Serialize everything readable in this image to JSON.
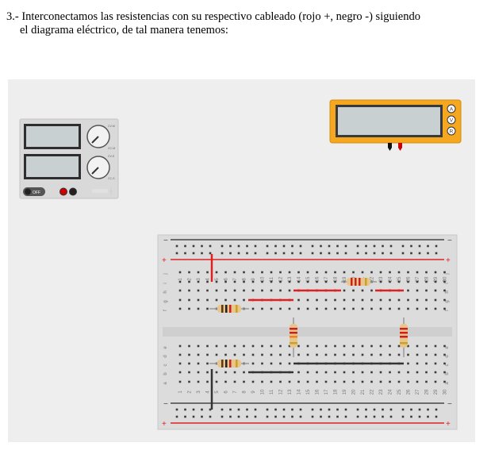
{
  "caption": {
    "line1": "3.- Interconectamos las resistencias con su respectivo cableado (rojo +, negro -) siguiendo",
    "line2": "el diagrama eléctrico, de tal manera tenemos:"
  },
  "power_supply": {
    "display1": "",
    "display2": "",
    "power_label": "OFF",
    "knob_labels": [
      "CV-M",
      "CC-M",
      "CV-S",
      "CC-S"
    ]
  },
  "multimeter": {
    "modes": [
      "A",
      "V",
      "R"
    ],
    "display": ""
  },
  "breadboard": {
    "rail_plus": "+",
    "rail_minus": "−",
    "rows_top": [
      "j",
      "i",
      "h",
      "g",
      "f"
    ],
    "rows_bottom": [
      "e",
      "d",
      "c",
      "b",
      "a"
    ],
    "column_count": 30
  },
  "colors": {
    "wire_red": "#e02020",
    "wire_black": "#333333",
    "meter_body": "#f5a81f",
    "probe_red": "#cc0000",
    "probe_black": "#111111"
  }
}
